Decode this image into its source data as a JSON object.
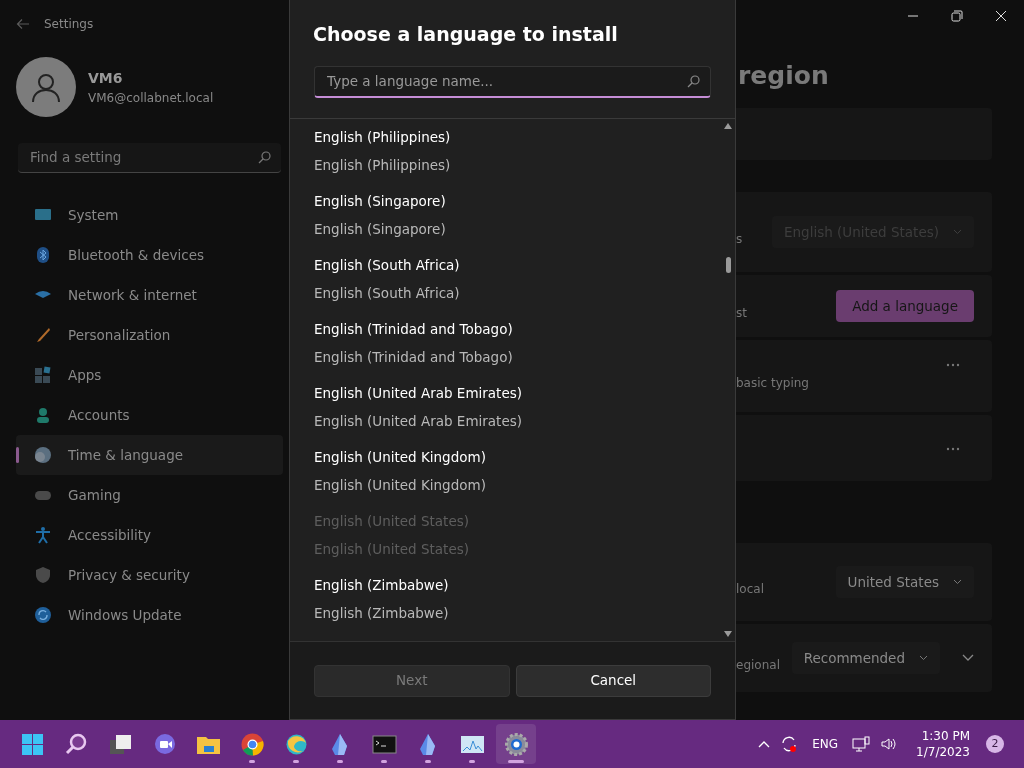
{
  "window": {
    "title": "Settings"
  },
  "account": {
    "name": "VM6",
    "email": "VM6@collabnet.local"
  },
  "search": {
    "placeholder": "Find a setting"
  },
  "nav": [
    {
      "label": "System",
      "kind": "system",
      "selected": false
    },
    {
      "label": "Bluetooth & devices",
      "kind": "bluetooth",
      "selected": false
    },
    {
      "label": "Network & internet",
      "kind": "network",
      "selected": false
    },
    {
      "label": "Personalization",
      "kind": "brush",
      "selected": false
    },
    {
      "label": "Apps",
      "kind": "apps",
      "selected": false
    },
    {
      "label": "Accounts",
      "kind": "accounts",
      "selected": false
    },
    {
      "label": "Time & language",
      "kind": "time",
      "selected": true
    },
    {
      "label": "Gaming",
      "kind": "gaming",
      "selected": false
    },
    {
      "label": "Accessibility",
      "kind": "accessibility",
      "selected": false
    },
    {
      "label": "Privacy & security",
      "kind": "privacy",
      "selected": false
    },
    {
      "label": "Windows Update",
      "kind": "update",
      "selected": false
    }
  ],
  "page": {
    "title": "region",
    "sections": [
      {
        "rows": [
          {
            "kind": "blank"
          }
        ]
      },
      {
        "rows": [
          {
            "kind": "dropdown",
            "label": "s",
            "value": "English (United States)",
            "disabled": true,
            "expander": false
          },
          {
            "kind": "button",
            "label": "st",
            "button": "Add a language"
          },
          {
            "kind": "more",
            "label": "basic typing"
          },
          {
            "kind": "more"
          }
        ]
      },
      {
        "rows": [
          {
            "kind": "dropdown",
            "label": "local",
            "value": "United States",
            "disabled": false,
            "expander": false
          },
          {
            "kind": "dropdown",
            "label": "egional",
            "value": "Recommended",
            "disabled": false,
            "expander": true
          }
        ]
      }
    ]
  },
  "dialog": {
    "title": "Choose a language to install",
    "search": {
      "placeholder": "Type a language name..."
    },
    "languages": [
      {
        "name": "English (Philippines)",
        "native": "English (Philippines)",
        "disabled": false
      },
      {
        "name": "English (Singapore)",
        "native": "English (Singapore)",
        "disabled": false
      },
      {
        "name": "English (South Africa)",
        "native": "English (South Africa)",
        "disabled": false
      },
      {
        "name": "English (Trinidad and Tobago)",
        "native": "English (Trinidad and Tobago)",
        "disabled": false
      },
      {
        "name": "English (United Arab Emirates)",
        "native": "English (United Arab Emirates)",
        "disabled": false
      },
      {
        "name": "English (United Kingdom)",
        "native": "English (United Kingdom)",
        "disabled": false
      },
      {
        "name": "English (United States)",
        "native": "English (United States)",
        "disabled": true
      },
      {
        "name": "English (Zimbabwe)",
        "native": "English (Zimbabwe)",
        "disabled": false
      }
    ],
    "buttons": [
      {
        "label": "Next",
        "kind": "primary",
        "disabled": true
      },
      {
        "label": "Cancel",
        "kind": "secondary",
        "disabled": false
      }
    ]
  },
  "taskbar": {
    "apps": [
      {
        "kind": "start",
        "running": false,
        "active": false
      },
      {
        "kind": "search",
        "running": false,
        "active": false
      },
      {
        "kind": "taskview",
        "running": false,
        "active": false
      },
      {
        "kind": "chat",
        "running": false,
        "active": false
      },
      {
        "kind": "folder",
        "running": false,
        "active": false
      },
      {
        "kind": "chrome",
        "running": true,
        "active": false
      },
      {
        "kind": "edge",
        "running": true,
        "active": false
      },
      {
        "kind": "crystal",
        "running": true,
        "active": false
      },
      {
        "kind": "terminal",
        "running": true,
        "active": false
      },
      {
        "kind": "crystal",
        "running": true,
        "active": false
      },
      {
        "kind": "monitor",
        "running": true,
        "active": false
      },
      {
        "kind": "settings",
        "running": true,
        "active": true
      }
    ],
    "language": "ENG",
    "time": "1:30 PM",
    "date": "1/7/2023",
    "notifications": "2"
  }
}
